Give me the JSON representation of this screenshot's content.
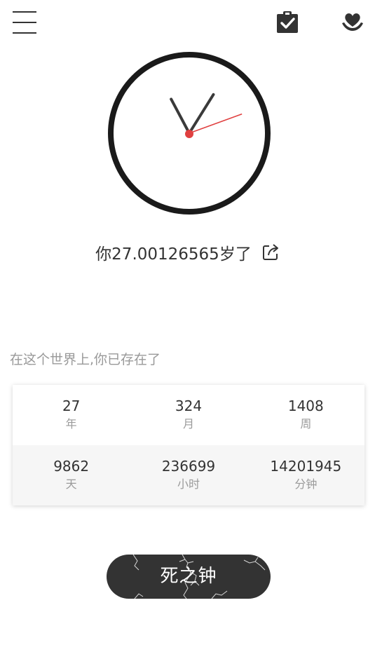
{
  "toolbar": {
    "menu_icon": "hamburger-menu-icon",
    "task_icon": "clipboard-check-icon",
    "heart_icon": "heart-hands-icon"
  },
  "clock": {
    "hour_hand_angle_deg": -28,
    "minute_hand_angle_deg": 32,
    "second_hand_angle_deg": 70,
    "accent_color": "#e04040"
  },
  "age": {
    "text": "你27.00126565岁了",
    "share_icon": "share-icon"
  },
  "existence": {
    "label": "在这个世界上,你已存在了",
    "rows": [
      [
        {
          "value": "27",
          "unit": "年"
        },
        {
          "value": "324",
          "unit": "月"
        },
        {
          "value": "1408",
          "unit": "周"
        }
      ],
      [
        {
          "value": "9862",
          "unit": "天"
        },
        {
          "value": "236699",
          "unit": "小时"
        },
        {
          "value": "14201945",
          "unit": "分钟"
        }
      ]
    ]
  },
  "death_button": {
    "label": "死之钟"
  },
  "colors": {
    "primary_dark": "#333333",
    "muted_text": "#999999",
    "alt_row_bg": "#f6f6f6"
  }
}
